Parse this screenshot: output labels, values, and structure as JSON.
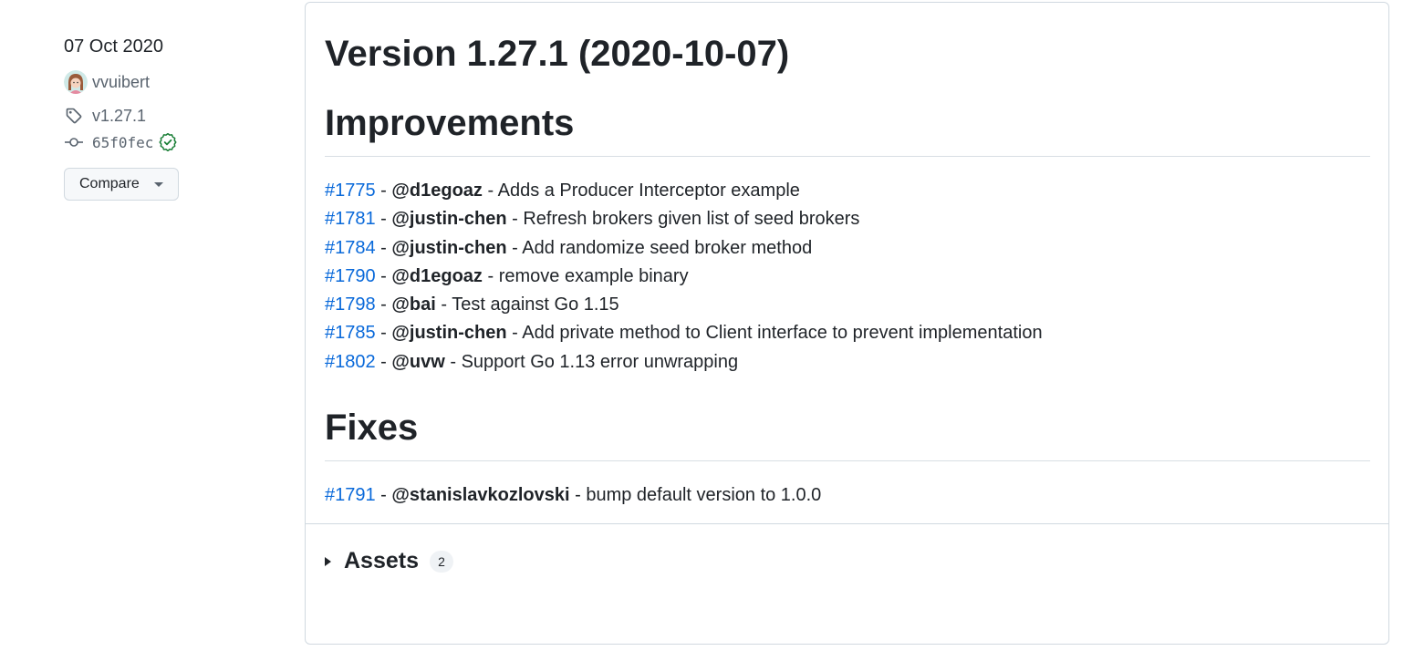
{
  "sidebar": {
    "date": "07 Oct 2020",
    "author": "vvuibert",
    "tag": "v1.27.1",
    "commit": "65f0fec",
    "compare_label": "Compare"
  },
  "release": {
    "title": "Version 1.27.1 (2020-10-07)",
    "improvements_heading": "Improvements",
    "improvements": [
      {
        "pr": "#1775",
        "sep1": " - ",
        "user": "@d1egoaz",
        "sep2": " - ",
        "desc": "Adds a Producer Interceptor example"
      },
      {
        "pr": "#1781",
        "sep1": " - ",
        "user": "@justin-chen",
        "sep2": " - ",
        "desc": "Refresh brokers given list of seed brokers"
      },
      {
        "pr": "#1784",
        "sep1": " - ",
        "user": "@justin-chen",
        "sep2": " - ",
        "desc": "Add randomize seed broker method"
      },
      {
        "pr": "#1790",
        "sep1": " - ",
        "user": "@d1egoaz",
        "sep2": " - ",
        "desc": "remove example binary"
      },
      {
        "pr": "#1798",
        "sep1": " - ",
        "user": "@bai",
        "sep2": " - ",
        "desc": "Test against Go 1.15"
      },
      {
        "pr": "#1785",
        "sep1": " - ",
        "user": "@justin-chen",
        "sep2": " - ",
        "desc": "Add private method to Client interface to prevent implementation"
      },
      {
        "pr": "#1802",
        "sep1": " - ",
        "user": "@uvw",
        "sep2": " - ",
        "desc": "Support Go 1.13 error unwrapping"
      }
    ],
    "fixes_heading": "Fixes",
    "fixes": [
      {
        "pr": "#1791",
        "sep1": " - ",
        "user": "@stanislavkozlovski",
        "sep2": " - ",
        "desc": "bump default version to 1.0.0"
      }
    ]
  },
  "assets": {
    "label": "Assets",
    "count": "2"
  },
  "colors": {
    "link": "#0969da",
    "verified": "#1a7f37",
    "muted": "#59636e",
    "border": "#d1d9e0"
  },
  "icons": {
    "tag": "tag-icon",
    "commit": "git-commit-icon",
    "verified": "verified-check-icon",
    "caret": "triangle-down-icon",
    "disclosure": "disclosure-triangle-icon"
  }
}
